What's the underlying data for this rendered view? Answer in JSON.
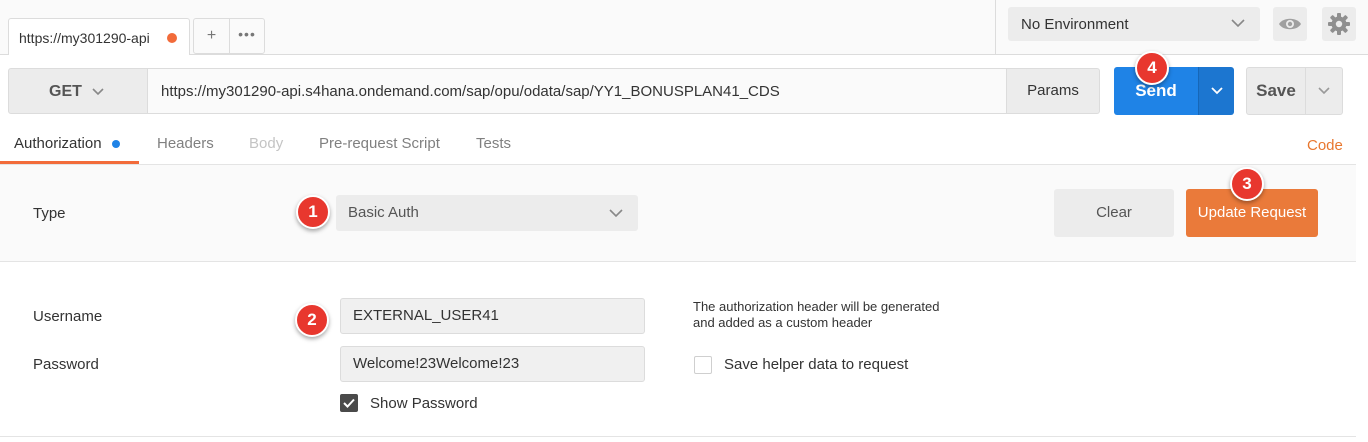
{
  "tabs": {
    "active_tab_title": "https://my301290-api",
    "add_label": "+",
    "more_label": "•••"
  },
  "environment": {
    "selected": "No Environment"
  },
  "request": {
    "method": "GET",
    "url": "https://my301290-api.s4hana.ondemand.com/sap/opu/odata/sap/YY1_BONUSPLAN41_CDS",
    "params_label": "Params",
    "send_label": "Send",
    "save_label": "Save"
  },
  "subtabs": {
    "authorization": "Authorization",
    "headers": "Headers",
    "body": "Body",
    "prerequest": "Pre-request Script",
    "tests": "Tests",
    "code": "Code"
  },
  "auth": {
    "type_label": "Type",
    "type_value": "Basic Auth",
    "clear_label": "Clear",
    "update_label": "Update Request",
    "username_label": "Username",
    "username_value": "EXTERNAL_USER41",
    "password_label": "Password",
    "password_value": "Welcome!23Welcome!23",
    "help_line1": "The authorization header will be generated",
    "help_line2": "and added as a custom header",
    "save_helper_label": "Save helper data to request",
    "save_helper_checked": false,
    "show_password_label": "Show Password",
    "show_password_checked": true
  },
  "markers": [
    "1",
    "2",
    "3",
    "4"
  ],
  "colors": {
    "accent_orange": "#f26b3a",
    "send_blue": "#1f83e6",
    "update_orange": "#ea7a3a",
    "marker_red": "#e8372e"
  }
}
